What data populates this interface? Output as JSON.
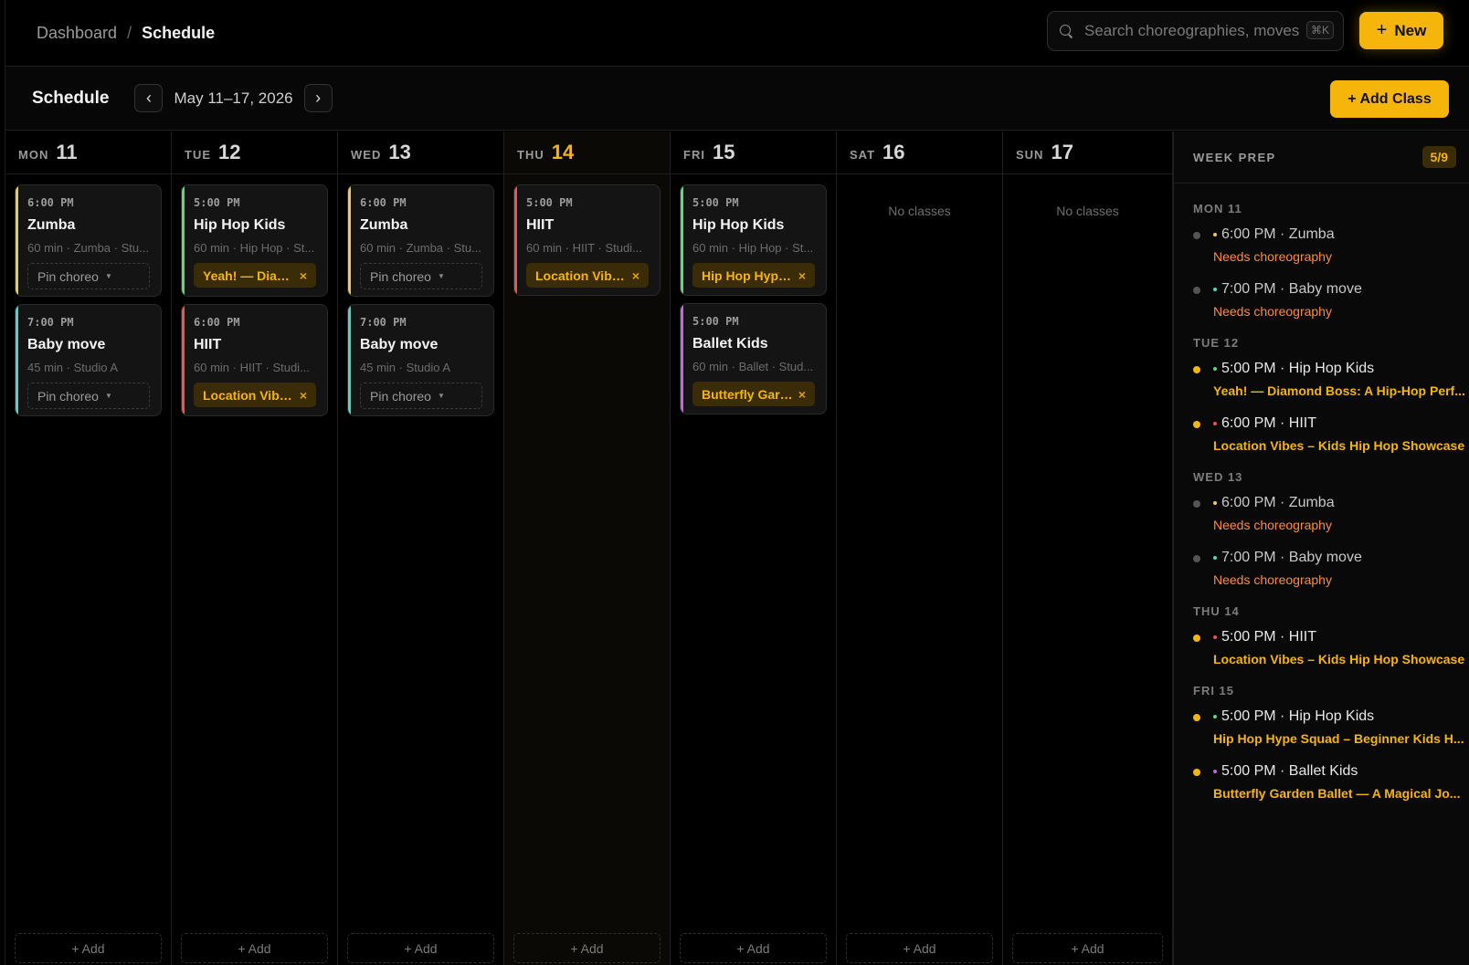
{
  "breadcrumb": {
    "parent": "Dashboard",
    "separator": "/",
    "current": "Schedule"
  },
  "search": {
    "placeholder": "Search choreographies, moves",
    "shortcut": "⌘K"
  },
  "new_button": {
    "icon": "+",
    "label": "New"
  },
  "schedule": {
    "title": "Schedule",
    "prev_icon": "‹",
    "next_icon": "›",
    "range": "May 11–17, 2026",
    "add_class_label": "+ Add Class"
  },
  "colors": {
    "accent": "#f5b50a",
    "zumba": "#f0c85a",
    "baby": "#4fd6c2",
    "hiphop": "#5fd68a",
    "hiit": "#e8545a",
    "ballet": "#c765e0",
    "need": "#ff8a3d"
  },
  "days": [
    {
      "dow": "MON",
      "num": "11"
    },
    {
      "dow": "TUE",
      "num": "12"
    },
    {
      "dow": "WED",
      "num": "13"
    },
    {
      "dow": "THU",
      "num": "14"
    },
    {
      "dow": "FRI",
      "num": "15"
    },
    {
      "dow": "SAT",
      "num": "16",
      "empty": "No classes"
    },
    {
      "dow": "SUN",
      "num": "17",
      "empty": "No classes"
    }
  ],
  "classes": {
    "mon_1": {
      "time": "6:00 PM",
      "name": "Zumba",
      "meta": "60 min · Zumba · Stu...",
      "pin": "Pin choreo"
    },
    "mon_2": {
      "time": "7:00 PM",
      "name": "Baby move",
      "meta": "45 min · Studio A",
      "pin": "Pin choreo"
    },
    "tue_1": {
      "time": "5:00 PM",
      "name": "Hip Hop Kids",
      "meta": "60 min · Hip Hop · St...",
      "tag": "Yeah! — Diam..."
    },
    "tue_2": {
      "time": "6:00 PM",
      "name": "HIIT",
      "meta": "60 min · HIIT · Studi...",
      "tag": "Location Vibe..."
    },
    "wed_1": {
      "time": "6:00 PM",
      "name": "Zumba",
      "meta": "60 min · Zumba · Stu...",
      "pin": "Pin choreo"
    },
    "wed_2": {
      "time": "7:00 PM",
      "name": "Baby move",
      "meta": "45 min · Studio A",
      "pin": "Pin choreo"
    },
    "thu_1": {
      "time": "5:00 PM",
      "name": "HIIT",
      "meta": "60 min · HIIT · Studi...",
      "tag": "Location Vibe..."
    },
    "fri_1": {
      "time": "5:00 PM",
      "name": "Hip Hop Kids",
      "meta": "60 min · Hip Hop · St...",
      "tag": "Hip Hop Hype..."
    },
    "fri_2": {
      "time": "5:00 PM",
      "name": "Ballet Kids",
      "meta": "60 min · Ballet · Stud...",
      "tag": "Butterfly Gard..."
    }
  },
  "add_label": "+ Add",
  "prep": {
    "title": "WEEK PREP",
    "count": "5/9",
    "groups": [
      {
        "day": "MON 11",
        "items": [
          {
            "line": "6:00 PM · Zumba",
            "sub": "Needs choreography"
          },
          {
            "line": "7:00 PM · Baby move",
            "sub": "Needs choreography"
          }
        ]
      },
      {
        "day": "TUE 12",
        "items": [
          {
            "line": "5:00 PM · Hip Hop Kids",
            "sub": "Yeah! — Diamond Boss: A Hip-Hop Perf..."
          },
          {
            "line": "6:00 PM · HIIT",
            "sub": "Location Vibes – Kids Hip Hop Showcase"
          }
        ]
      },
      {
        "day": "WED 13",
        "items": [
          {
            "line": "6:00 PM · Zumba",
            "sub": "Needs choreography"
          },
          {
            "line": "7:00 PM · Baby move",
            "sub": "Needs choreography"
          }
        ]
      },
      {
        "day": "THU 14",
        "items": [
          {
            "line": "5:00 PM · HIIT",
            "sub": "Location Vibes – Kids Hip Hop Showcase"
          }
        ]
      },
      {
        "day": "FRI 15",
        "items": [
          {
            "line": "5:00 PM · Hip Hop Kids",
            "sub": "Hip Hop Hype Squad – Beginner Kids H..."
          },
          {
            "line": "5:00 PM · Ballet Kids",
            "sub": "Butterfly Garden Ballet — A Magical Jo..."
          }
        ]
      }
    ]
  }
}
